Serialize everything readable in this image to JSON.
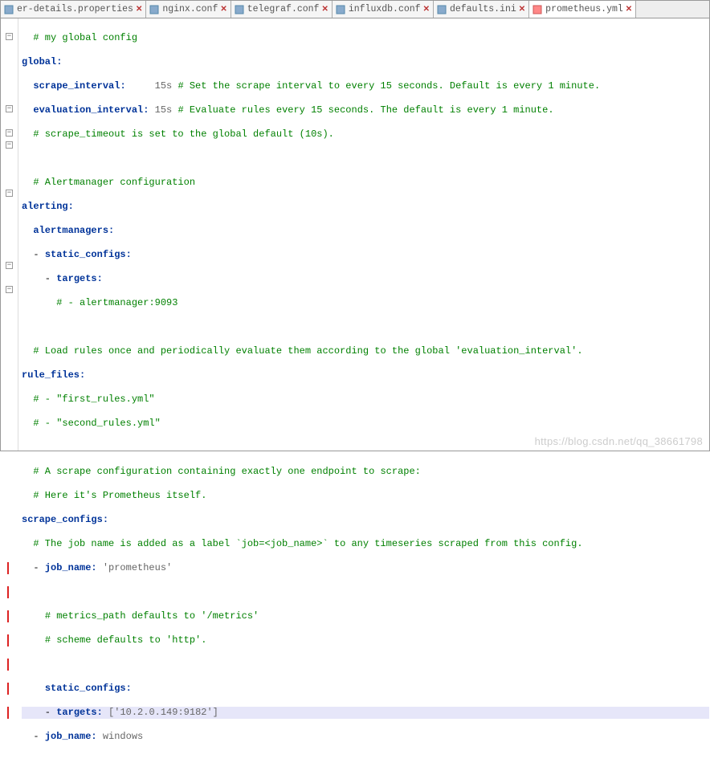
{
  "tabs": [
    {
      "label": "er-details.properties",
      "active": false
    },
    {
      "label": "nginx.conf",
      "active": false
    },
    {
      "label": "telegraf.conf",
      "active": false
    },
    {
      "label": "influxdb.conf",
      "active": false
    },
    {
      "label": "defaults.ini",
      "active": false
    },
    {
      "label": "prometheus.yml",
      "active": true
    }
  ],
  "close_glyph": "✕",
  "code": {
    "l1": "# my global config",
    "l2_k": "global",
    "l3_k": "scrape_interval",
    "l3_v": "     15s ",
    "l3_c": "# Set the scrape interval to every 15 seconds. Default is every 1 minute.",
    "l4_k": "evaluation_interval",
    "l4_v": " 15s ",
    "l4_c": "# Evaluate rules every 15 seconds. The default is every 1 minute.",
    "l5": "# scrape_timeout is set to the global default (10s).",
    "l7": "# Alertmanager configuration",
    "l8_k": "alerting",
    "l9_k": "alertmanagers",
    "l10_k": "static_configs",
    "l11_k": "targets",
    "l12": "# - alertmanager:9093",
    "l14": "# Load rules once and periodically evaluate them according to the global 'evaluation_interval'.",
    "l15_k": "rule_files",
    "l16": "# - \"first_rules.yml\"",
    "l17": "# - \"second_rules.yml\"",
    "l19": "# A scrape configuration containing exactly one endpoint to scrape:",
    "l20": "# Here it's Prometheus itself.",
    "l21_k": "scrape_configs",
    "l22": "# The job name is added as a label `job=<job_name>` to any timeseries scraped from this config.",
    "l23_k": "job_name",
    "l23_v": " 'prometheus'",
    "l25": "# metrics_path defaults to '/metrics'",
    "l26": "# scheme defaults to 'http'.",
    "l28_k": "static_configs",
    "l29_k": "targets",
    "l29_v": " ['10.2.0.149:9182']",
    "l30_k": "job_name",
    "l30_v": " windows"
  },
  "watermark": "https://blog.csdn.net/qq_38661798"
}
